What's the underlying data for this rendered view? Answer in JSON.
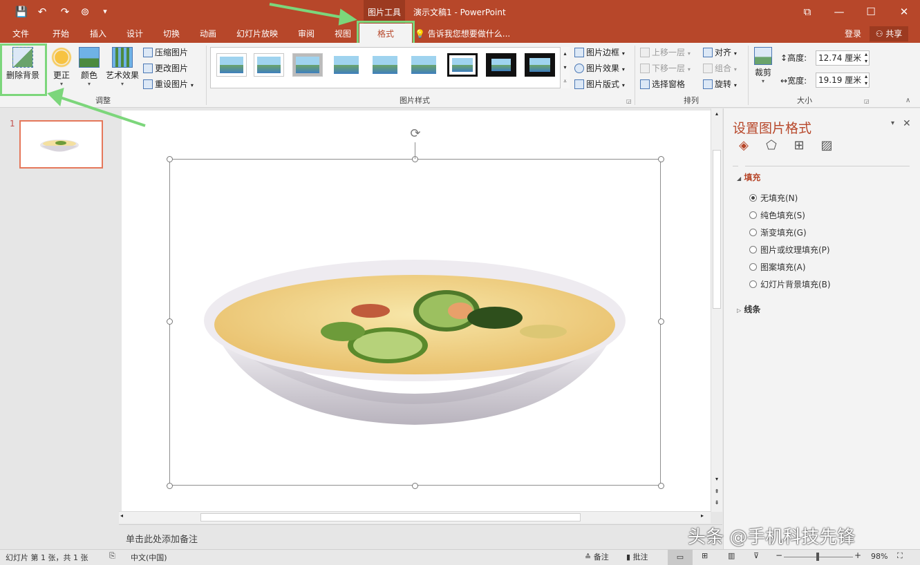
{
  "window": {
    "context_tab_group": "图片工具",
    "title": "演示文稿1 - PowerPoint",
    "controls": {
      "restore_ribbon": "⧉",
      "minimize": "—",
      "maximize": "☐",
      "close": "✕"
    }
  },
  "qat": {
    "save": "💾",
    "undo": "↶",
    "redo": "↷",
    "present": "⊚",
    "more": "▾"
  },
  "menu": {
    "items": [
      "文件",
      "开始",
      "插入",
      "设计",
      "切换",
      "动画",
      "幻灯片放映",
      "审阅",
      "视图"
    ],
    "active": "格式",
    "tell_me": "告诉我您想要做什么...",
    "login": "登录",
    "share": "共享"
  },
  "ribbon": {
    "adjust": {
      "label": "调整",
      "remove_bg": "删除背景",
      "correct": "更正",
      "color": "颜色",
      "artistic": "艺术效果",
      "compress": "压缩图片",
      "change": "更改图片",
      "reset": "重设图片"
    },
    "styles": {
      "label": "图片样式",
      "border": "图片边框",
      "effects": "图片效果",
      "layout": "图片版式"
    },
    "arrange": {
      "label": "排列",
      "bring_forward": "上移一层",
      "send_backward": "下移一层",
      "selection_pane": "选择窗格",
      "align": "对齐",
      "group": "组合",
      "rotate": "旋转"
    },
    "size": {
      "label": "大小",
      "crop": "裁剪",
      "height_label": "高度:",
      "height_value": "12.74 厘米",
      "width_label": "宽度:",
      "width_value": "19.19 厘米"
    }
  },
  "thumbnails": {
    "number": "1"
  },
  "notes": {
    "placeholder": "单击此处添加备注"
  },
  "format_pane": {
    "title": "设置图片格式",
    "fill_section": "填充",
    "options": [
      "无填充(N)",
      "纯色填充(S)",
      "渐变填充(G)",
      "图片或纹理填充(P)",
      "图案填充(A)",
      "幻灯片背景填充(B)"
    ],
    "selected_index": 0,
    "line_section": "线条"
  },
  "statusbar": {
    "slide_info": "幻灯片 第 1 张，共 1 张",
    "language": "中文(中国)",
    "notes": "备注",
    "comments": "批注",
    "zoom": "98%"
  },
  "watermark": "头条 @手机科技先锋",
  "colors": {
    "accent": "#b7472a",
    "highlight": "#7cd67b"
  }
}
